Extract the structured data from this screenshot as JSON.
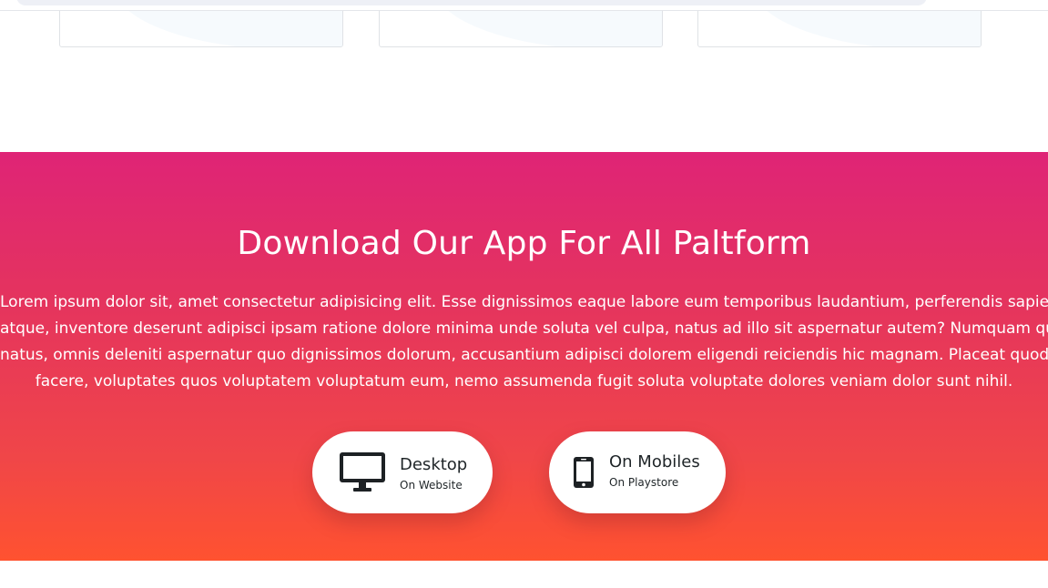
{
  "download": {
    "title": "Download Our App For All Paltform",
    "paragraph_lines": [
      "Lorem ipsum dolor sit, amet consectetur adipisicing elit. Esse dignissimos eaque labore eum temporibus laudantium, perferendis sapiente",
      "atque, inventore deserunt adipisci ipsam ratione dolore minima unde soluta vel culpa, natus ad illo sit aspernatur autem? Numquam quasi,",
      "natus, omnis deleniti aspernatur quo dignissimos dolorum, accusantium adipisci dolorem eligendi reiciendis hic magnam. Placeat quod",
      "facere, voluptates quos voluptatem voluptatum eum, nemo assumenda fugit soluta voluptate dolores veniam dolor sunt nihil."
    ],
    "buttons": [
      {
        "title": "Desktop",
        "subtitle": "On Website",
        "icon": "desktop-monitor-icon"
      },
      {
        "title": "On Mobiles",
        "subtitle": "On Playstore",
        "icon": "mobile-phone-icon"
      }
    ]
  },
  "colors": {
    "gradient_top": "#df2476",
    "gradient_bottom": "#ff5230",
    "button_bg": "#ffffff",
    "button_text": "#1f2528"
  }
}
